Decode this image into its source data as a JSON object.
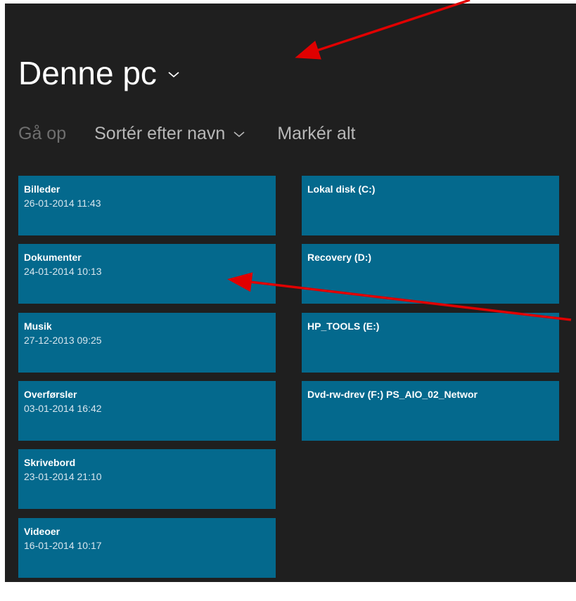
{
  "header": {
    "title": "Denne pc",
    "title_dropdown_icon": "chevron-down-icon"
  },
  "commands": {
    "up_label": "Gå op",
    "sort_label": "Sortér efter navn",
    "sort_dropdown_icon": "chevron-down-icon",
    "select_all_label": "Markér alt"
  },
  "folders": [
    {
      "name": "Billeder",
      "date": "26-01-2014 11:43"
    },
    {
      "name": "Dokumenter",
      "date": "24-01-2014 10:13"
    },
    {
      "name": "Musik",
      "date": "27-12-2013 09:25"
    },
    {
      "name": "Overførsler",
      "date": "03-01-2014 16:42"
    },
    {
      "name": "Skrivebord",
      "date": "23-01-2014 21:10"
    },
    {
      "name": "Videoer",
      "date": "16-01-2014 10:17"
    }
  ],
  "drives": [
    {
      "name": "Lokal disk (C:)"
    },
    {
      "name": "Recovery (D:)"
    },
    {
      "name": "HP_TOOLS (E:)"
    },
    {
      "name": "Dvd-rw-drev (F:) PS_AIO_02_Networ"
    }
  ],
  "colors": {
    "background": "#1f1f1f",
    "tile": "#04698d",
    "annotation_arrow": "#e00000"
  }
}
